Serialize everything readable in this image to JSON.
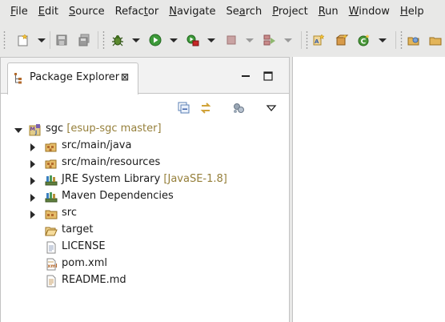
{
  "menubar": {
    "items": [
      {
        "first": "F",
        "rest": "ile"
      },
      {
        "first": "E",
        "rest": "dit"
      },
      {
        "first": "S",
        "rest": "ource"
      },
      {
        "first": "",
        "rest": "Refac",
        "u": "t",
        "tail": "or"
      },
      {
        "first": "N",
        "rest": "avigate"
      },
      {
        "first": "",
        "rest": "Se",
        "u": "a",
        "tail": "rch"
      },
      {
        "first": "P",
        "rest": "roject"
      },
      {
        "first": "R",
        "rest": "un"
      },
      {
        "first": "W",
        "rest": "indow"
      },
      {
        "first": "H",
        "rest": "elp"
      }
    ]
  },
  "toolbar": {
    "icons": [
      "new-wizard-icon",
      "save-icon",
      "save-all-icon",
      "debug-icon",
      "run-icon",
      "external-tools-icon",
      "stop-icon",
      "coverage-icon",
      "new-java-project-icon",
      "new-package-icon",
      "new-class-icon",
      "open-type-icon",
      "open-task-icon"
    ]
  },
  "view": {
    "tab_label": "Package Explorer",
    "close_glyph": "⊠",
    "minimize_label": "minimize",
    "maximize_label": "maximize"
  },
  "tree": {
    "rows": [
      {
        "name": "sgc",
        "decoration": "[esup-sgc master]",
        "icon": "maven-project-icon",
        "toggle": "expanded",
        "level": 0
      },
      {
        "name": "src/main/java",
        "decoration": "",
        "icon": "source-folder-icon",
        "toggle": "collapsed",
        "level": 1
      },
      {
        "name": "src/main/resources",
        "decoration": "",
        "icon": "source-folder-icon",
        "toggle": "collapsed",
        "level": 1
      },
      {
        "name": "JRE System Library",
        "decoration": "[JavaSE-1.8]",
        "icon": "library-icon",
        "toggle": "collapsed",
        "level": 1
      },
      {
        "name": "Maven Dependencies",
        "decoration": "",
        "icon": "library-icon",
        "toggle": "collapsed",
        "level": 1
      },
      {
        "name": "src",
        "decoration": "",
        "icon": "folder-icon",
        "toggle": "collapsed",
        "level": 1
      },
      {
        "name": "target",
        "decoration": "",
        "icon": "open-folder-icon",
        "toggle": "none",
        "level": 1
      },
      {
        "name": "LICENSE",
        "decoration": "",
        "icon": "file-icon",
        "toggle": "none",
        "level": 1
      },
      {
        "name": "pom.xml",
        "decoration": "",
        "icon": "xml-file-icon",
        "toggle": "none",
        "level": 1
      },
      {
        "name": "README.md",
        "decoration": "",
        "icon": "text-file-icon",
        "toggle": "none",
        "level": 1
      }
    ]
  }
}
